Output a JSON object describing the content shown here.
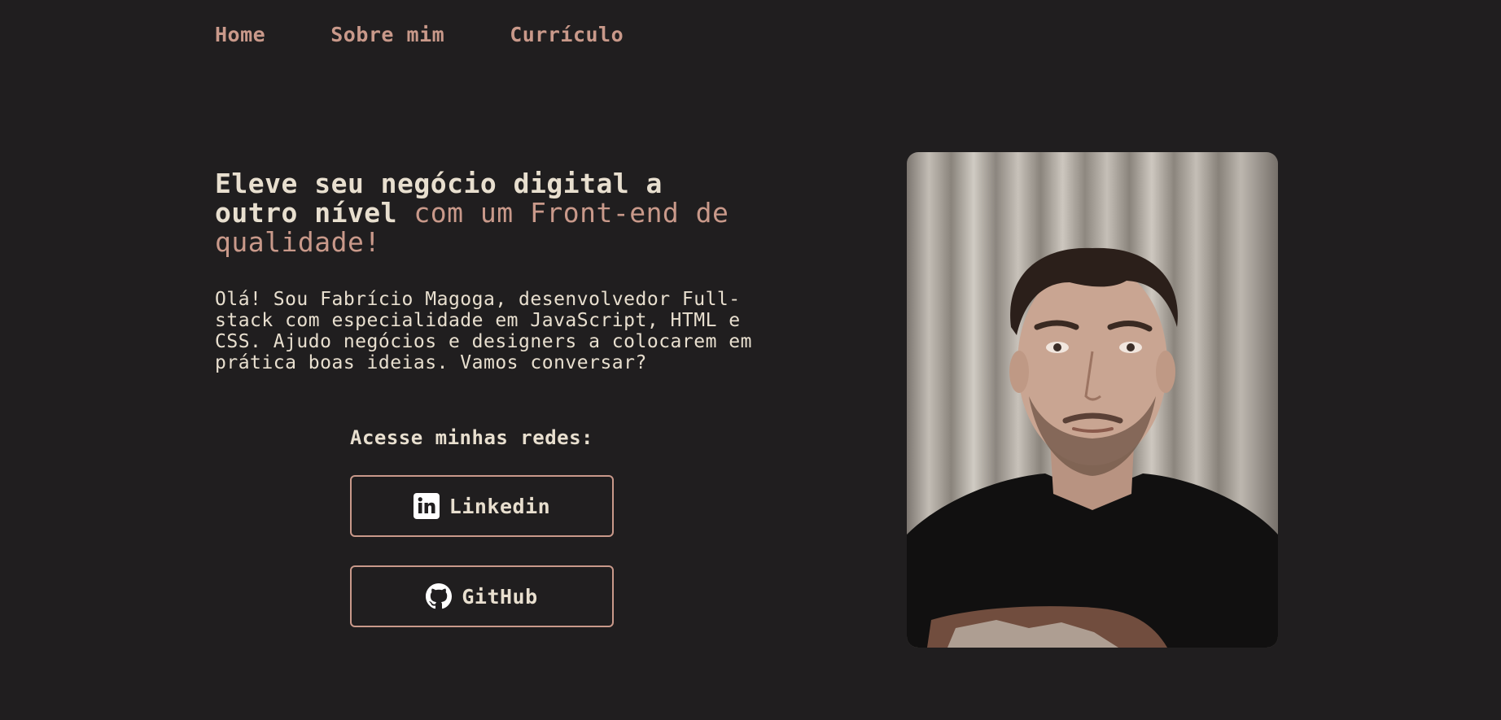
{
  "nav": {
    "items": [
      "Home",
      "Sobre mim",
      "Currículo"
    ]
  },
  "hero": {
    "headline_plain": "Eleve seu negócio digital a outro nível ",
    "headline_accent": "com um Front-end de qualidade!",
    "intro": "Olá! Sou Fabrício Magoga, desenvolvedor Full-stack com especialidade em JavaScript, HTML e CSS. Ajudo negócios e designers a colocarem em prática boas ideias. Vamos conversar?",
    "networks_label": "Acesse minhas redes:"
  },
  "social": {
    "linkedin": {
      "label": "Linkedin",
      "icon": "linkedin-icon"
    },
    "github": {
      "label": "GitHub",
      "icon": "github-icon"
    }
  },
  "photo": {
    "subject": "profile-photo"
  },
  "colors": {
    "background": "#201e1f",
    "accent": "#c9998a",
    "text": "#e8dfcf"
  }
}
